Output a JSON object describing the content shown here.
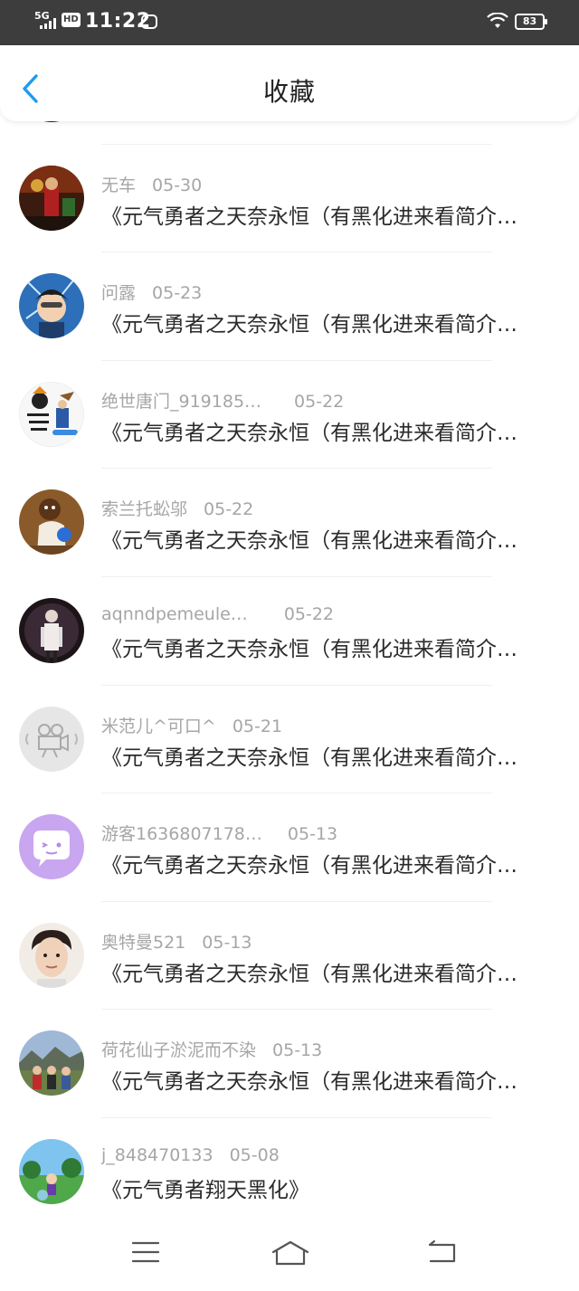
{
  "status_bar": {
    "network": "5G",
    "hd": "HD",
    "time": "11:22",
    "battery": "83"
  },
  "header": {
    "title": "收藏"
  },
  "items": [
    {
      "name": "",
      "date": "",
      "title": ""
    },
    {
      "name": "无车",
      "date": "05-30",
      "title": "《元气勇者之天奈永恒（有黑化进来看简介…"
    },
    {
      "name": "问露",
      "date": "05-23",
      "title": "《元气勇者之天奈永恒（有黑化进来看简介…"
    },
    {
      "name": "绝世唐门_919185…",
      "date": "05-22",
      "title": "《元气勇者之天奈永恒（有黑化进来看简介…"
    },
    {
      "name": "索兰托蚣邬",
      "date": "05-22",
      "title": "《元气勇者之天奈永恒（有黑化进来看简介…"
    },
    {
      "name": "aqnndpemeule…",
      "date": "05-22",
      "title": "《元气勇者之天奈永恒（有黑化进来看简介…"
    },
    {
      "name": "米范儿^可口^",
      "date": "05-21",
      "title": "《元气勇者之天奈永恒（有黑化进来看简介…"
    },
    {
      "name": "游客1636807178…",
      "date": "05-13",
      "title": "《元气勇者之天奈永恒（有黑化进来看简介…"
    },
    {
      "name": "奥特曼521",
      "date": "05-13",
      "title": "《元气勇者之天奈永恒（有黑化进来看简介…"
    },
    {
      "name": "荷花仙子淤泥而不染",
      "date": "05-13",
      "title": "《元气勇者之天奈永恒（有黑化进来看简介…"
    },
    {
      "name": "j_848470133",
      "date": "05-08",
      "title": "《元气勇者翔天黑化》"
    }
  ],
  "avatars": [
    "game-warrior",
    "game-warrior",
    "anime-boy",
    "text-logo",
    "cartoon-bear",
    "dark-figure",
    "default-camera",
    "purple-chat",
    "young-man",
    "group-photo",
    "game-field"
  ],
  "nav": {
    "icons": [
      "menu-icon",
      "home-icon",
      "back-arrow-icon"
    ]
  },
  "colors": {
    "accent": "#1e9bf0",
    "meta": "#a6a6a6",
    "title": "#2b2b2b",
    "status_bar": "#3d3d3d"
  }
}
